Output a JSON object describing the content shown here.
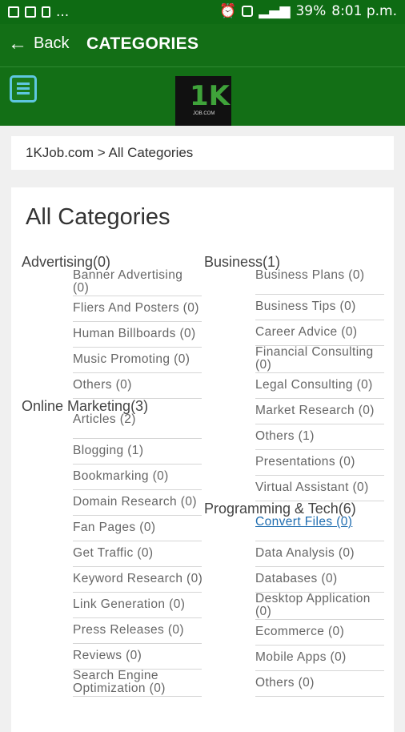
{
  "status": {
    "battery": "39%",
    "time": "8:01 p.m.",
    "dots": "..."
  },
  "appbar": {
    "back_label": "Back",
    "title": "CATEGORIES"
  },
  "logo": {
    "big": "1K",
    "small": "JOB.COM"
  },
  "breadcrumb": "1KJob.com > All Categories",
  "page_title": "All Categories",
  "col1": [
    {
      "name": "Advertising(0)",
      "subs": [
        "Banner Advertising (0)",
        "Fliers And Posters (0)",
        "Human Billboards (0)",
        "Music Promoting (0)",
        "Others (0)"
      ]
    },
    {
      "name": "Online Marketing(3)",
      "subs": [
        "Articles (2)",
        "Blogging (1)",
        "Bookmarking (0)",
        "Domain Research (0)",
        "Fan Pages (0)",
        "Get Traffic (0)",
        "Keyword Research (0)",
        "Link Generation (0)",
        "Press Releases (0)",
        "Reviews (0)",
        "Search Engine Optimization (0)"
      ]
    }
  ],
  "col2": [
    {
      "name": "Business(1)",
      "subs": [
        "Business Plans (0)",
        "Business Tips (0)",
        "Career Advice (0)",
        "Financial Consulting (0)",
        "Legal Consulting (0)",
        "Market Research (0)",
        "Others (1)",
        "Presentations (0)",
        "Virtual Assistant (0)"
      ]
    },
    {
      "name": "Programming & Tech(6)",
      "subs": [
        "Convert Files (0)",
        "Data Analysis (0)",
        "Databases (0)",
        "Desktop Application (0)",
        "Ecommerce (0)",
        "Mobile Apps (0)",
        "Others (0)"
      ]
    }
  ],
  "accent_color": "#136f16",
  "link_color": "#1f6db0"
}
